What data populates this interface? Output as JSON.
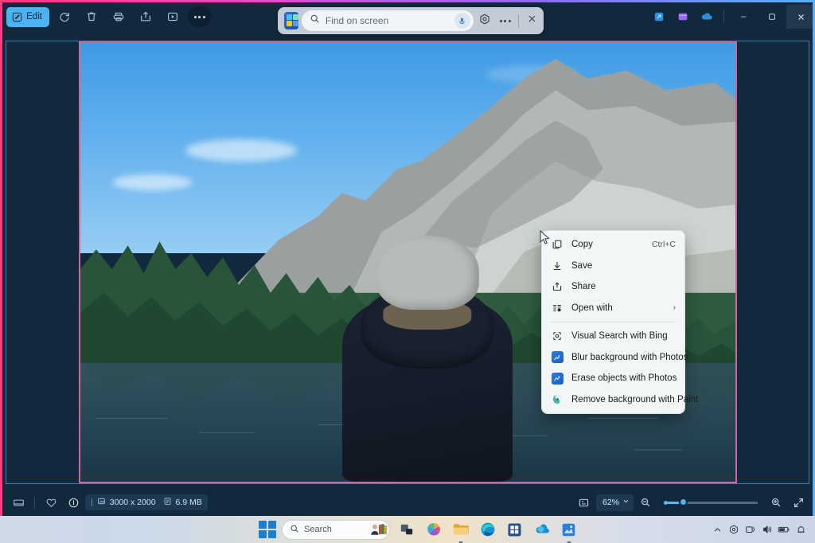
{
  "app": {
    "toolbar": {
      "edit_label": "Edit",
      "items": [
        {
          "name": "edit-button",
          "label": "Edit",
          "icon": "edit-icon"
        },
        {
          "name": "rotate-button",
          "label": "Rotate",
          "icon": "rotate-icon"
        },
        {
          "name": "delete-button",
          "label": "Delete",
          "icon": "trash-icon"
        },
        {
          "name": "print-button",
          "label": "Print",
          "icon": "printer-icon"
        },
        {
          "name": "share-button",
          "label": "Share",
          "icon": "share-icon"
        },
        {
          "name": "slideshow-button",
          "label": "Slideshow",
          "icon": "slideshow-icon"
        },
        {
          "name": "see-more-button",
          "label": "See more",
          "icon": "ellipsis-icon"
        }
      ]
    },
    "window_controls": {
      "minimize": "–",
      "maximize": "⬜",
      "close": "✕"
    },
    "statusbar": {
      "dimensions": "3000 x 2000",
      "filesize": "6.9 MB",
      "zoom_level": "62%",
      "icons": [
        "filmstrip-icon",
        "favorite-icon",
        "info-icon",
        "image-size-icon",
        "file-size-icon"
      ]
    },
    "zoom_controls": {
      "fit_label": "Fit to window",
      "zoom_out": "zoom-out-icon",
      "zoom_in": "zoom-in-icon",
      "fullscreen": "fullscreen-icon"
    }
  },
  "findbar": {
    "placeholder": "Find on screen",
    "value": "",
    "app_icon": "click-to-do-icon",
    "mic_icon": "microphone-icon",
    "settings_icon": "visual-search-icon",
    "more_icon": "ellipsis-icon",
    "close_icon": "close-icon"
  },
  "context_menu": {
    "items": [
      {
        "label": "Copy",
        "accel": "Ctrl+C",
        "icon": "copy-icon",
        "submenu": false,
        "sep_after": false
      },
      {
        "label": "Save",
        "accel": "",
        "icon": "save-icon",
        "submenu": false,
        "sep_after": false
      },
      {
        "label": "Share",
        "accel": "",
        "icon": "share-icon",
        "submenu": false,
        "sep_after": false
      },
      {
        "label": "Open with",
        "accel": "",
        "icon": "open-with-icon",
        "submenu": true,
        "sep_after": true
      },
      {
        "label": "Visual Search with Bing",
        "accel": "",
        "icon": "visual-search-icon",
        "submenu": false,
        "sep_after": false
      },
      {
        "label": "Blur background with Photos",
        "accel": "",
        "icon": "photos-app-icon",
        "submenu": false,
        "sep_after": false
      },
      {
        "label": "Erase objects with Photos",
        "accel": "",
        "icon": "photos-app-icon",
        "submenu": false,
        "sep_after": false
      },
      {
        "label": "Remove background with Paint",
        "accel": "",
        "icon": "paint-app-icon",
        "submenu": false,
        "sep_after": false
      }
    ],
    "submenu_arrow": "›"
  },
  "taskbar": {
    "search_placeholder": "Search",
    "start_label": "Start",
    "apps": [
      {
        "name": "task-view-button",
        "label": "Task view"
      },
      {
        "name": "copilot-button",
        "label": "Copilot"
      },
      {
        "name": "file-explorer-button",
        "label": "File Explorer"
      },
      {
        "name": "edge-button",
        "label": "Microsoft Edge"
      },
      {
        "name": "store-button",
        "label": "Microsoft Store"
      },
      {
        "name": "onedrive-button",
        "label": "OneDrive"
      },
      {
        "name": "photos-button",
        "label": "Photos"
      }
    ],
    "tray": [
      {
        "name": "show-hidden-icons-button",
        "label": "Show hidden icons",
        "glyph": "∧"
      },
      {
        "name": "copilot-tray-icon",
        "label": "Copilot"
      },
      {
        "name": "network-tray-icon",
        "label": "Network"
      },
      {
        "name": "volume-tray-icon",
        "label": "Volume"
      },
      {
        "name": "battery-tray-icon",
        "label": "Battery"
      },
      {
        "name": "notification-tray-icon",
        "label": "Notifications"
      }
    ]
  },
  "photo": {
    "alt": "Person in gray beanie and dark jacket viewed from behind, facing a mountain lake with pine forest and rocky peak"
  },
  "colors": {
    "accent": "#4cb3f0",
    "app_bg": "#12293d",
    "cdt_border_start": "#ff3b7f",
    "cdt_border_end": "#5ab0f5",
    "selection_border": "#c86b95",
    "menu_bg": "#f3f6f6"
  }
}
